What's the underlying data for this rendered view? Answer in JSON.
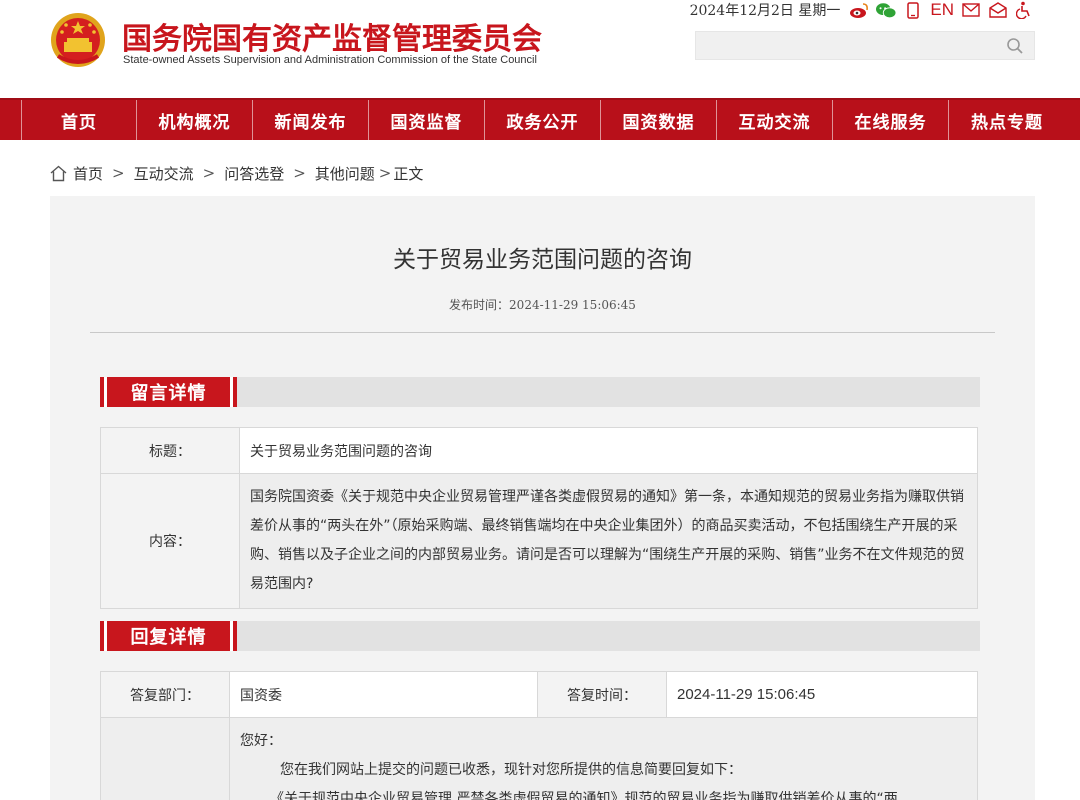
{
  "header": {
    "logo_cn": "国务院国有资产监督管理委员会",
    "logo_en": "State-owned Assets Supervision and Administration Commission of the State Council",
    "date": "2024年12月2日  星期一",
    "en_label": "EN",
    "search_placeholder": "",
    "accent_color": "#c8161d",
    "icons": [
      "weibo-icon",
      "wechat-icon",
      "mobile-icon",
      "mail-icon",
      "message-icon",
      "accessibility-icon",
      "search-icon"
    ]
  },
  "nav": {
    "items": [
      "首页",
      "机构概况",
      "新闻发布",
      "国资监督",
      "政务公开",
      "国资数据",
      "互动交流",
      "在线服务",
      "热点专题"
    ]
  },
  "breadcrumb": {
    "items": [
      "首页",
      "互动交流",
      "问答选登",
      "其他问题",
      "正文"
    ],
    "separators": [
      ">",
      ">",
      ">",
      ">"
    ]
  },
  "article": {
    "title": "关于贸易业务范围问题的咨询",
    "pub_label": "发布时间：",
    "pub_time": "2024-11-29 15:06:45"
  },
  "message": {
    "section_title": "留言详情",
    "title_label": "标题：",
    "title_value": "关于贸易业务范围问题的咨询",
    "content_label": "内容：",
    "content_value": "国务院国资委《关于规范中央企业贸易管理严谨各类虚假贸易的通知》第一条，本通知规范的贸易业务指为赚取供销差价从事的“两头在外”（原始采购端、最终销售端均在中央企业集团外）的商品买卖活动，不包括围绕生产开展的采购、销售以及子企业之间的内部贸易业务。请问是否可以理解为“围绕生产开展的采购、销售”业务不在文件规范的贸易范围内?"
  },
  "reply": {
    "section_title": "回复详情",
    "dept_label": "答复部门：",
    "dept_value": "国资委",
    "time_label": "答复时间：",
    "time_value": "2024-11-29 15:06:45",
    "greeting": "您好：",
    "line1": "您在我们网站上提交的问题已收悉，现针对您所提供的信息简要回复如下：",
    "line2": "《关于规范中央企业贸易管理 严禁各类虚假贸易的通知》规范的贸易业务指为赚取供销差价从事的“两"
  }
}
